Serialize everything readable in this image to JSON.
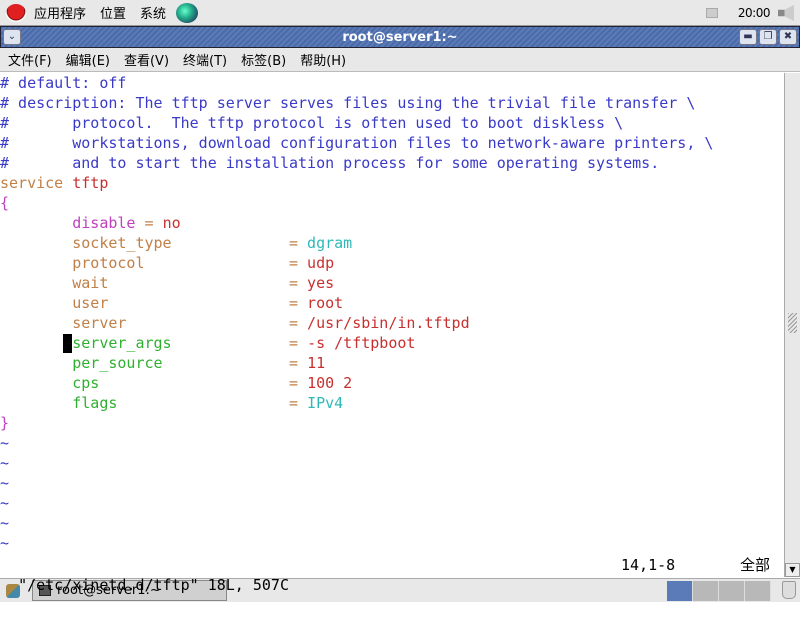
{
  "top_panel": {
    "menus": [
      "应用程序",
      "位置",
      "系统"
    ],
    "clock": "20:00"
  },
  "window": {
    "title": "root@server1:~"
  },
  "menubar": [
    "文件(F)",
    "编辑(E)",
    "查看(V)",
    "终端(T)",
    "标签(B)",
    "帮助(H)"
  ],
  "lines": [
    [
      [
        "c",
        "# default: off"
      ]
    ],
    [
      [
        "c",
        "# description: The tftp server serves files using the trivial file transfer \\"
      ]
    ],
    [
      [
        "c",
        "#       protocol.  The tftp protocol is often used to boot diskless \\"
      ]
    ],
    [
      [
        "c",
        "#       workstations, download configuration files to network-aware printers, \\"
      ]
    ],
    [
      [
        "c",
        "#       and to start the installation process for some operating systems."
      ]
    ],
    [
      [
        "k",
        "service "
      ],
      [
        "v",
        "tftp"
      ]
    ],
    [
      [
        "m",
        "{"
      ]
    ],
    [
      [
        "m",
        "        disable"
      ],
      [
        "k",
        " = "
      ],
      [
        "v",
        "no"
      ]
    ],
    [
      [
        "k",
        "        socket_type             = "
      ],
      [
        "cy",
        "dgram"
      ]
    ],
    [
      [
        "k",
        "        protocol                = "
      ],
      [
        "v",
        "udp"
      ]
    ],
    [
      [
        "k",
        "        wait                    = "
      ],
      [
        "v",
        "yes"
      ]
    ],
    [
      [
        "k",
        "        user                    = "
      ],
      [
        "v",
        "root"
      ]
    ],
    [
      [
        "k",
        "        server                  = "
      ],
      [
        "v",
        "/usr/sbin/in.tftpd"
      ]
    ],
    [
      [
        "g",
        "        server_args"
      ],
      [
        "k",
        "             = "
      ],
      [
        "v",
        "-s /tftpboot"
      ]
    ],
    [
      [
        "g",
        "        per_source"
      ],
      [
        "k",
        "              = "
      ],
      [
        "v",
        "11"
      ]
    ],
    [
      [
        "g",
        "        cps"
      ],
      [
        "k",
        "                     = "
      ],
      [
        "v",
        "100 2"
      ]
    ],
    [
      [
        "g",
        "        flags"
      ],
      [
        "k",
        "                   = "
      ],
      [
        "cy",
        "IPv4"
      ]
    ],
    [
      [
        "m",
        "}"
      ]
    ],
    [
      [
        "t",
        "~"
      ]
    ],
    [
      [
        "t",
        "~"
      ]
    ],
    [
      [
        "t",
        "~"
      ]
    ],
    [
      [
        "t",
        "~"
      ]
    ],
    [
      [
        "t",
        "~"
      ]
    ],
    [
      [
        "t",
        "~"
      ]
    ]
  ],
  "status": {
    "file": "\"/etc/xinetd.d/tftp\" 18L, 507C",
    "position": "14,1-8",
    "scroll": "全部"
  },
  "cursor_line": 13,
  "taskbar": {
    "task": "root@server1:~",
    "active_workspace": 1,
    "workspaces": 4
  }
}
